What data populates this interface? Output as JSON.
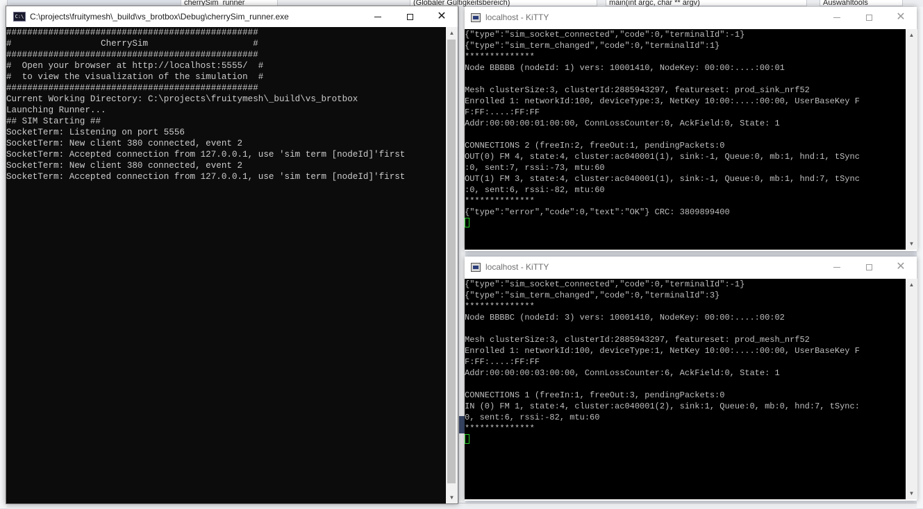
{
  "console": {
    "title": "C:\\projects\\fruitymesh\\_build\\vs_brotbox\\Debug\\cherrySim_runner.exe",
    "icon": "console-app-icon",
    "lines": [
      "################################################",
      "#                 CherrySim                    #",
      "################################################",
      "#  Open your browser at http://localhost:5555/  #",
      "#  to view the visualization of the simulation  #",
      "################################################",
      "Current Working Directory: C:\\projects\\fruitymesh\\_build\\vs_brotbox",
      "Launching Runner...",
      "## SIM Starting ##",
      "SocketTerm: Listening on port 5556",
      "SocketTerm: New client 380 connected, event 2",
      "SocketTerm: Accepted connection from 127.0.0.1, use 'sim term [nodeId]'first",
      "SocketTerm: New client 380 connected, event 2",
      "SocketTerm: Accepted connection from 127.0.0.1, use 'sim term [nodeId]'first"
    ]
  },
  "kitty_top": {
    "title": "localhost - KiTTY",
    "icon": "kitty-icon",
    "lines": [
      "{\"type\":\"sim_socket_connected\",\"code\":0,\"terminalId\":-1}",
      "{\"type\":\"sim_term_changed\",\"code\":0,\"terminalId\":1}",
      "**************",
      "Node BBBBB (nodeId: 1) vers: 10001410, NodeKey: 00:00:....:00:01",
      "",
      "Mesh clusterSize:3, clusterId:2885943297, featureset: prod_sink_nrf52",
      "Enrolled 1: networkId:100, deviceType:3, NetKey 10:00:....:00:00, UserBaseKey F",
      "F:FF:....:FF:FF",
      "Addr:00:00:00:01:00:00, ConnLossCounter:0, AckField:0, State: 1",
      "",
      "CONNECTIONS 2 (freeIn:2, freeOut:1, pendingPackets:0",
      "OUT(0) FM 4, state:4, cluster:ac040001(1), sink:-1, Queue:0, mb:1, hnd:1, tSync",
      ":0, sent:7, rssi:-73, mtu:60",
      "OUT(1) FM 3, state:4, cluster:ac040001(1), sink:-1, Queue:0, mb:1, hnd:7, tSync",
      ":0, sent:6, rssi:-82, mtu:60",
      "**************",
      "{\"type\":\"error\",\"code\":0,\"text\":\"OK\"} CRC: 3809899400"
    ]
  },
  "kitty_bottom": {
    "title": "localhost - KiTTY",
    "icon": "kitty-icon",
    "lines": [
      "{\"type\":\"sim_socket_connected\",\"code\":0,\"terminalId\":-1}",
      "{\"type\":\"sim_term_changed\",\"code\":0,\"terminalId\":3}",
      "**************",
      "Node BBBBC (nodeId: 3) vers: 10001410, NodeKey: 00:00:....:00:02",
      "",
      "Mesh clusterSize:3, clusterId:2885943297, featureset: prod_mesh_nrf52",
      "Enrolled 1: networkId:100, deviceType:1, NetKey 10:00:....:00:00, UserBaseKey F",
      "F:FF:....:FF:FF",
      "Addr:00:00:00:03:00:00, ConnLossCounter:6, AckField:0, State: 1",
      "",
      "CONNECTIONS 1 (freeIn:1, freeOut:3, pendingPackets:0",
      "IN (0) FM 1, state:4, cluster:ac040001(2), sink:1, Queue:0, mb:0, hnd:7, tSync:",
      "0, sent:6, rssi:-82, mtu:60",
      "**************"
    ]
  },
  "background": {
    "combo_left": "cherrySim_runner",
    "combo_scope": "(Globaler Gültigkeitsbereich)",
    "combo_function": "main(int argc, char ** argv)",
    "toolbar_button": "Auswahltools"
  },
  "colors": {
    "terminal_bg": "#0c0c0c",
    "terminal_fg": "#cccccc",
    "cursor": "#28d228"
  }
}
